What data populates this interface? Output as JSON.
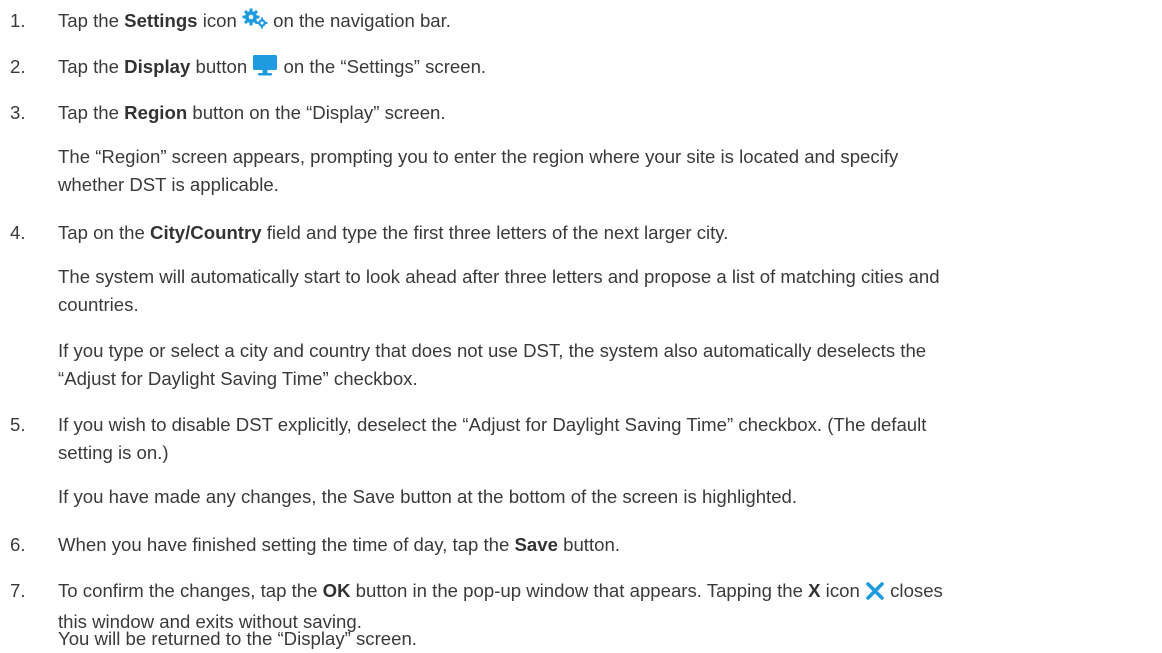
{
  "steps": [
    {
      "number": "1.",
      "parts": [
        "Tap the ",
        "Settings",
        " icon ",
        " on the navigation bar."
      ],
      "icon": "gears-icon"
    },
    {
      "number": "2.",
      "parts": [
        "Tap the ",
        "Display",
        " button ",
        " on the “Settings” screen."
      ],
      "icon": "monitor-icon"
    },
    {
      "number": "3.",
      "parts": [
        "Tap the ",
        "Region",
        " button on the “Display” screen."
      ],
      "notes": [
        "The “Region” screen appears, prompting you to enter the region where your site is located and specify",
        "whether DST is applicable."
      ]
    },
    {
      "number": "4.",
      "parts": [
        "Tap on the ",
        "City/Country",
        " field and type the first three letters of the next larger city."
      ],
      "notes": [
        "The system will automatically start to look ahead after three letters and propose a list of matching cities and",
        "countries.",
        "If you type or select a city and country that does not use DST, the system also automatically deselects the",
        "“Adjust for Daylight Saving Time” checkbox."
      ]
    },
    {
      "number": "5.",
      "lines": [
        "If you wish to disable DST explicitly, deselect the “Adjust for Daylight Saving Time” checkbox. (The default",
        "setting is on.)"
      ],
      "notes": [
        "If you have made any changes, the Save button at the bottom of the screen is highlighted."
      ]
    },
    {
      "number": "6.",
      "parts": [
        "When you have finished setting the time of day, tap the ",
        "Save",
        " button."
      ]
    },
    {
      "number": "7.",
      "parts": [
        "To confirm the changes, tap the ",
        "OK",
        " button in the pop-up window that appears. Tapping the ",
        "X",
        " icon ",
        " closes"
      ],
      "continuation": "this window and exits without saving.",
      "icon": "close-icon",
      "notes": [
        "You will be returned to the “Display” screen."
      ]
    }
  ],
  "colors": {
    "text": "#3a3a3a",
    "icon_blue": "#1e9be0"
  }
}
